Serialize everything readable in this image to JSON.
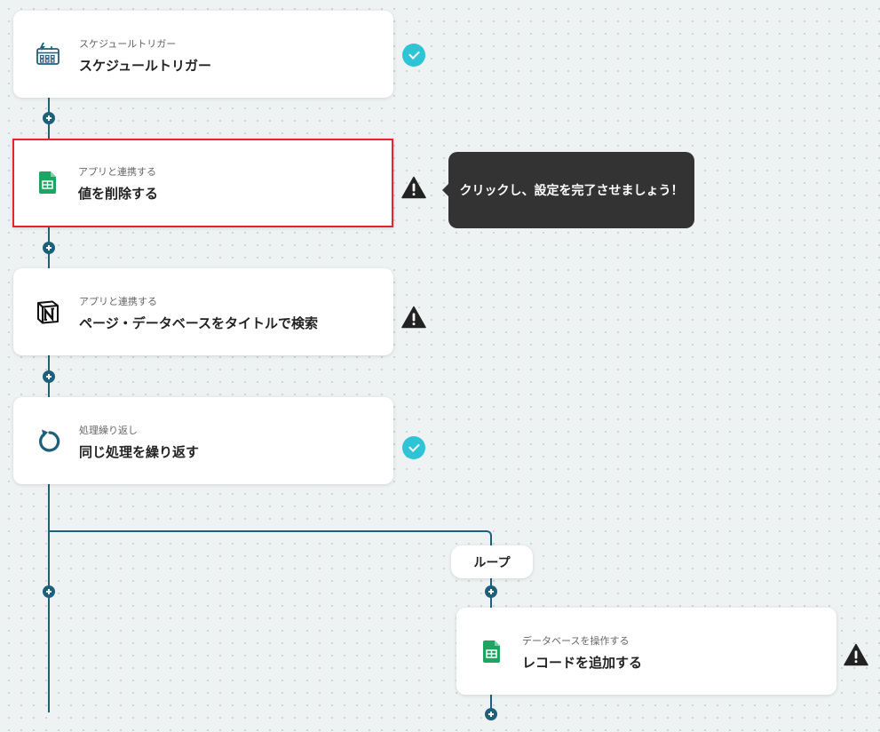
{
  "steps": [
    {
      "subtitle": "スケジュールトリガー",
      "title": "スケジュールトリガー",
      "icon": "calendar-schedule-icon",
      "status": "complete"
    },
    {
      "subtitle": "アプリと連携する",
      "title": "値を削除する",
      "icon": "google-sheets-icon",
      "status": "warning"
    },
    {
      "subtitle": "アプリと連携する",
      "title": "ページ・データベースをタイトルで検索",
      "icon": "notion-icon",
      "status": "warning"
    },
    {
      "subtitle": "処理繰り返し",
      "title": "同じ処理を繰り返す",
      "icon": "loop-arrow-icon",
      "status": "complete"
    },
    {
      "subtitle": "データベースを操作する",
      "title": "レコードを追加する",
      "icon": "google-sheets-icon",
      "status": "warning"
    }
  ],
  "tooltip": {
    "text": "クリックし、設定を完了させましょう！"
  },
  "loop_label": "ループ",
  "colors": {
    "connector": "#1e5f7a",
    "check": "#2ec4d6",
    "warning": "#222222",
    "selected_border": "#e8242a",
    "sheets_green": "#1fa463",
    "tooltip_bg": "#333333"
  }
}
